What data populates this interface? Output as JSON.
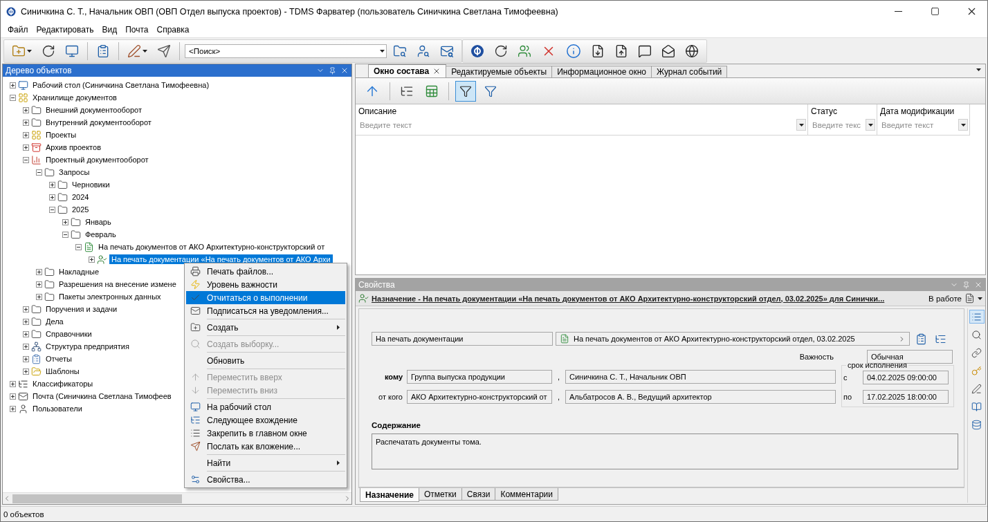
{
  "window": {
    "title": "Синичкина С. Т., Начальник ОВП (ОВП Отдел выпуска проектов) - TDMS Фарватер (пользователь Синичкина Светлана Тимофеевна)"
  },
  "menu": [
    "Файл",
    "Редактировать",
    "Вид",
    "Почта",
    "Справка"
  ],
  "toolbar": {
    "search": {
      "value": "<Поиск>"
    }
  },
  "tree_panel": {
    "title": "Дерево объектов",
    "items": [
      {
        "label": "Рабочий стол (Синичкина Светлана Тимофеевна)",
        "kind": "desktop",
        "expanded": false,
        "selected": false
      },
      {
        "label": "Хранилище документов",
        "kind": "storage",
        "expanded": true,
        "selected": false,
        "children": [
          {
            "label": "Внешний документооборот",
            "kind": "folder",
            "expanded": false,
            "selected": false
          },
          {
            "label": "Внутренний документооборот",
            "kind": "folder",
            "expanded": false,
            "selected": false
          },
          {
            "label": "Проекты",
            "kind": "storage",
            "expanded": false,
            "selected": false
          },
          {
            "label": "Архив проектов",
            "kind": "archive",
            "expanded": false,
            "selected": false
          },
          {
            "label": "Проектный документооборот",
            "kind": "chart",
            "expanded": true,
            "selected": false,
            "children": [
              {
                "label": "Запросы",
                "kind": "folder",
                "expanded": true,
                "selected": false,
                "children": [
                  {
                    "label": "Черновики",
                    "kind": "folder",
                    "expanded": false,
                    "selected": false
                  },
                  {
                    "label": "2024",
                    "kind": "folder",
                    "expanded": false,
                    "selected": false
                  },
                  {
                    "label": "2025",
                    "kind": "folder",
                    "expanded": true,
                    "selected": false,
                    "children": [
                      {
                        "label": "Январь",
                        "kind": "folder",
                        "expanded": false,
                        "selected": false
                      },
                      {
                        "label": "Февраль",
                        "kind": "folder",
                        "expanded": true,
                        "selected": false,
                        "children": [
                          {
                            "label": "На печать документов от АКО Архитектурно-конструкторский от",
                            "kind": "document",
                            "expanded": true,
                            "selected": false,
                            "children": [
                              {
                                "label": "На печать документации «На печать документов от АКО Архи",
                                "kind": "assignment",
                                "expanded": false,
                                "selected": true
                              }
                            ]
                          }
                        ]
                      }
                    ]
                  }
                ]
              },
              {
                "label": "Накладные",
                "kind": "folder",
                "expanded": false,
                "selected": false
              },
              {
                "label": "Разрешения на внесение измене",
                "kind": "folder",
                "expanded": false,
                "selected": false
              },
              {
                "label": "Пакеты электронных данных",
                "kind": "folder",
                "expanded": false,
                "selected": false
              }
            ]
          },
          {
            "label": "Поручения и задачи",
            "kind": "folder",
            "expanded": false,
            "selected": false
          },
          {
            "label": "Дела",
            "kind": "folder",
            "expanded": false,
            "selected": false
          },
          {
            "label": "Справочники",
            "kind": "folder",
            "expanded": false,
            "selected": false
          },
          {
            "label": "Структура предприятия",
            "kind": "org",
            "expanded": false,
            "selected": false
          },
          {
            "label": "Отчеты",
            "kind": "reports",
            "expanded": false,
            "selected": false
          },
          {
            "label": "Шаблоны",
            "kind": "templates",
            "expanded": false,
            "selected": false
          }
        ]
      },
      {
        "label": "Классификаторы",
        "kind": "classifier",
        "expanded": false,
        "selected": false
      },
      {
        "label": "Почта (Синичкина Светлана Тимофеев",
        "kind": "mail",
        "expanded": false,
        "selected": false
      },
      {
        "label": "Пользователи",
        "kind": "users",
        "expanded": false,
        "selected": false
      }
    ]
  },
  "context_menu": {
    "items": [
      {
        "label": "Печать файлов...",
        "disabled": false,
        "selected": false,
        "submenu": false,
        "separator_before": false
      },
      {
        "label": "Уровень важности",
        "disabled": false,
        "selected": false,
        "submenu": false,
        "separator_before": false
      },
      {
        "label": "Отчитаться о выполнении",
        "disabled": false,
        "selected": true,
        "submenu": false,
        "separator_before": false
      },
      {
        "label": "Подписаться на уведомления...",
        "disabled": false,
        "selected": false,
        "submenu": false,
        "separator_before": false
      },
      {
        "label": "Создать",
        "disabled": false,
        "selected": false,
        "submenu": true,
        "separator_before": true
      },
      {
        "label": "Создать выборку...",
        "disabled": true,
        "selected": false,
        "submenu": false,
        "separator_before": true
      },
      {
        "label": "Обновить",
        "disabled": false,
        "selected": false,
        "submenu": false,
        "separator_before": true
      },
      {
        "label": "Переместить вверх",
        "disabled": true,
        "selected": false,
        "submenu": false,
        "separator_before": true
      },
      {
        "label": "Переместить вниз",
        "disabled": true,
        "selected": false,
        "submenu": false,
        "separator_before": false
      },
      {
        "label": "На рабочий стол",
        "disabled": false,
        "selected": false,
        "submenu": false,
        "separator_before": true
      },
      {
        "label": "Следующее вхождение",
        "disabled": false,
        "selected": false,
        "submenu": false,
        "separator_before": false
      },
      {
        "label": "Закрепить в главном окне",
        "disabled": false,
        "selected": false,
        "submenu": false,
        "separator_before": false
      },
      {
        "label": "Послать как вложение...",
        "disabled": false,
        "selected": false,
        "submenu": false,
        "separator_before": false
      },
      {
        "label": "Найти",
        "disabled": false,
        "selected": false,
        "submenu": true,
        "separator_before": true
      },
      {
        "label": "Свойства...",
        "disabled": false,
        "selected": false,
        "submenu": false,
        "separator_before": true
      }
    ]
  },
  "composition": {
    "tabs": [
      {
        "label": "Окно состава",
        "selected": true
      },
      {
        "label": "Редактируемые объекты",
        "selected": false
      },
      {
        "label": "Информационное окно",
        "selected": false
      },
      {
        "label": "Журнал событий",
        "selected": false
      }
    ],
    "filter_active": true,
    "columns": [
      {
        "label": "Описание",
        "placeholder": "Введите текст"
      },
      {
        "label": "Статус",
        "placeholder": "Введите текс"
      },
      {
        "label": "Дата модификации",
        "placeholder": "Введите текст"
      }
    ]
  },
  "properties": {
    "title": "Свойства",
    "header": {
      "link": "Назначение - На печать документации «На печать документов от АКО Архитектурно-конструкторский отдел, 03.02.2025» для Синички...",
      "status": "В работе"
    },
    "name_field": "На печать документации",
    "parent_field": "На печать документов от АКО Архитектурно-конструкторский отдел, 03.02.2025",
    "importance": {
      "label": "Важность",
      "value": "Обычная"
    },
    "parties": [
      {
        "label": "кому",
        "required": true,
        "group": "Группа выпуска продукции",
        "separator": ",",
        "person": "Синичкина С. Т., Начальник ОВП"
      },
      {
        "label": "от кого",
        "required": false,
        "group": "АКО Архитектурно-конструкторский от",
        "separator": ",",
        "person": "Альбатросов А. В., Ведущий архитектор"
      }
    ],
    "deadline": {
      "legend": "срок исполнения",
      "rows": [
        {
          "label": "с",
          "value": "04.02.2025 09:00:00"
        },
        {
          "label": "по",
          "value": "17.02.2025 18:00:00"
        }
      ]
    },
    "content": {
      "label": "Содержание",
      "text": "Распечатать документы тома."
    },
    "tabs": [
      {
        "label": "Назначение",
        "selected": true
      },
      {
        "label": "Отметки",
        "selected": false
      },
      {
        "label": "Связи",
        "selected": false
      },
      {
        "label": "Комментарии",
        "selected": false
      }
    ]
  },
  "status_bar": {
    "text": "0 объектов"
  }
}
